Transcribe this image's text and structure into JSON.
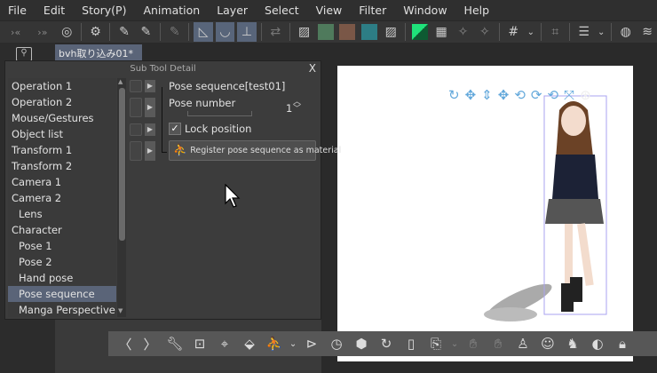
{
  "menu": [
    "File",
    "Edit",
    "Story(P)",
    "Animation",
    "Layer",
    "Select",
    "View",
    "Filter",
    "Window",
    "Help"
  ],
  "tab": {
    "label": "bvh取り込み01*",
    "dot": "●"
  },
  "panel": {
    "title": "Sub Tool Detail",
    "close": "X",
    "categories": [
      {
        "label": "Operation 1"
      },
      {
        "label": "Operation 2"
      },
      {
        "label": "Mouse/Gestures"
      },
      {
        "label": "Object list"
      },
      {
        "label": "Transform 1"
      },
      {
        "label": "Transform 2"
      },
      {
        "label": "Camera 1"
      },
      {
        "label": "Camera 2"
      },
      {
        "label": "Lens",
        "sub": true
      },
      {
        "label": "Character"
      },
      {
        "label": "Pose 1",
        "sub": true
      },
      {
        "label": "Pose 2",
        "sub": true
      },
      {
        "label": "Hand pose",
        "sub": true
      },
      {
        "label": "Pose sequence",
        "sub": true,
        "selected": true
      },
      {
        "label": "Manga Perspective",
        "sub": true
      }
    ],
    "group_title": "Pose sequence[test01]",
    "pose_number_label": "Pose number",
    "pose_number_value": "1",
    "lock_position_label": "Lock position",
    "lock_position_checked": true,
    "register_button": "Register pose sequence as material"
  },
  "colors": {
    "accent": "#5a6478",
    "manipulator": "#62a8db"
  }
}
